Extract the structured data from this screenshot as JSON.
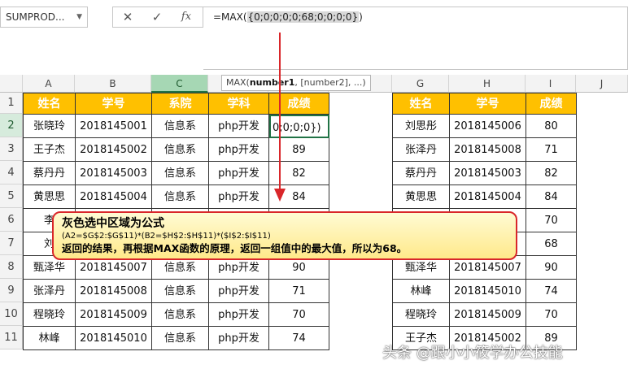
{
  "namebox": {
    "value": "SUMPROD...",
    "dropdown_icon": "chevron-down-icon"
  },
  "formula_buttons": {
    "cancel": "✕",
    "enter": "✓",
    "fx": "fx"
  },
  "formula": {
    "prefix": "=MAX(",
    "array": "{0;0;0;0;0;68;0;0;0;0}",
    "suffix": ")"
  },
  "tooltip": {
    "func": "MAX(",
    "arg1": "number1",
    "rest": ", [number2], ...)"
  },
  "columns": [
    "A",
    "B",
    "C",
    "D",
    "E",
    "F",
    "G",
    "H",
    "I",
    "J"
  ],
  "rows": [
    "1",
    "2",
    "3",
    "4",
    "5",
    "6",
    "7",
    "8",
    "9",
    "10",
    "11"
  ],
  "left_table": {
    "headers": [
      "姓名",
      "学号",
      "系院",
      "学科",
      "成绩"
    ],
    "rows": [
      [
        "张晓玲",
        "2018145001",
        "信息系",
        "php开发",
        "0;0;0;0})"
      ],
      [
        "王子杰",
        "2018145002",
        "信息系",
        "php开发",
        "89"
      ],
      [
        "蔡丹丹",
        "2018145003",
        "信息系",
        "php开发",
        "82"
      ],
      [
        "黄思思",
        "2018145004",
        "信息系",
        "php开发",
        "84"
      ],
      [
        "李",
        "",
        "",
        "",
        ""
      ],
      [
        "刘",
        "",
        "",
        "",
        ""
      ],
      [
        "甄泽华",
        "2018145007",
        "信息系",
        "php开发",
        "90"
      ],
      [
        "张泽丹",
        "2018145008",
        "信息系",
        "php开发",
        "71"
      ],
      [
        "程晓玲",
        "2018145009",
        "信息系",
        "php开发",
        "70"
      ],
      [
        "林峰",
        "2018145010",
        "信息系",
        "php开发",
        "74"
      ]
    ]
  },
  "right_table": {
    "headers": [
      "姓名",
      "学号",
      "成绩"
    ],
    "rows": [
      [
        "刘思彤",
        "2018145006",
        "80"
      ],
      [
        "张泽丹",
        "2018145008",
        "71"
      ],
      [
        "蔡丹丹",
        "2018145003",
        "82"
      ],
      [
        "黄思思",
        "2018145004",
        "84"
      ],
      [
        "",
        "",
        "70"
      ],
      [
        "",
        "",
        "68"
      ],
      [
        "甄泽华",
        "2018145007",
        "90"
      ],
      [
        "林峰",
        "2018145010",
        "74"
      ],
      [
        "程晓玲",
        "2018145009",
        "70"
      ],
      [
        "王子杰",
        "2018145002",
        "89"
      ]
    ]
  },
  "callout": {
    "line1": "灰色选中区域为公式",
    "line2": "(A2=$G$2:$G$11)*(B2=$H$2:$H$11)*($I$2:$I$11)",
    "line3": "返回的结果，再根据MAX函数的原理，返回一组值中的最大值，所以为68。"
  },
  "watermark": "头条 @跟小小筱学办公技能",
  "colors": {
    "header_fill": "#ffc000",
    "selected_col": "#a6d7b4",
    "accent_green": "#217346",
    "arrow_red": "#d9262a"
  }
}
